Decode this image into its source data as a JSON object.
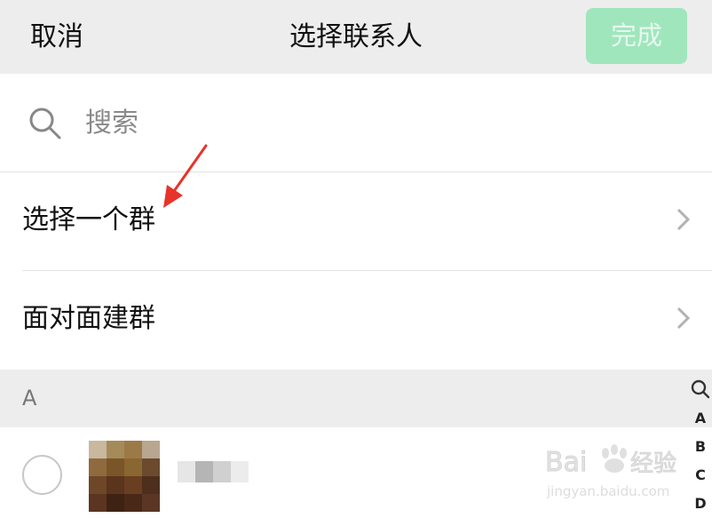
{
  "nav": {
    "cancel_label": "取消",
    "title": "选择联系人",
    "done_label": "完成",
    "done_color": "#9fe6bd"
  },
  "search": {
    "placeholder": "搜索",
    "icon": "search-icon"
  },
  "options": [
    {
      "label": "选择一个群",
      "icon": "chevron-right-icon"
    },
    {
      "label": "面对面建群",
      "icon": "chevron-right-icon"
    }
  ],
  "section": {
    "letter": "A"
  },
  "index": [
    "A",
    "B",
    "C",
    "D"
  ],
  "watermark": {
    "brand": "Bai",
    "brand_suffix": "经验",
    "url": "jingyan.baidu.com"
  },
  "colors": {
    "nav_bg": "#ededed",
    "annotation_arrow": "#e8332a",
    "divider": "#e3e3e3"
  }
}
